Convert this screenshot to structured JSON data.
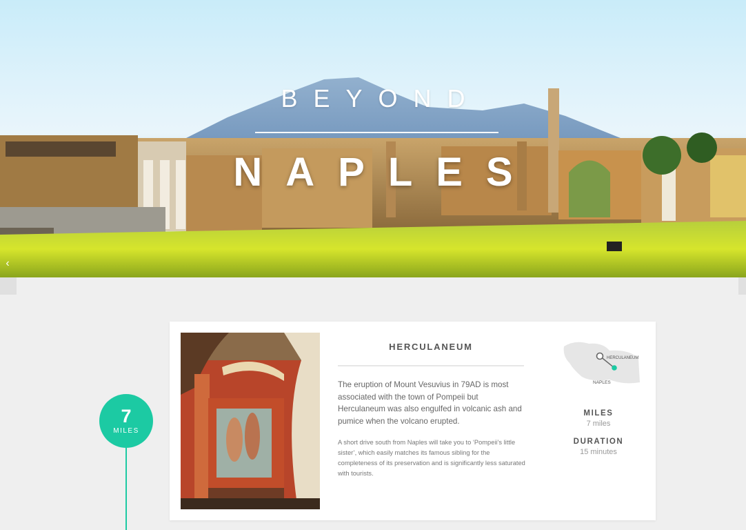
{
  "hero": {
    "title_top": "BEYOND",
    "title_main": "NAPLES",
    "prev_arrow": "‹"
  },
  "timeline": {
    "distance_value": "7",
    "distance_unit": "MILES"
  },
  "card": {
    "title": "HERCULANEUM",
    "paragraph_main": "The eruption of Mount Vesuvius in 79AD is most associated with the town of Pompeii but Herculaneum was also engulfed in volcanic ash and pumice when the volcano erupted.",
    "paragraph_secondary": "A short drive south from Naples will take you to ‘Pompeii’s little sister’, which easily matches its famous sibling for the completeness of its preservation and is significantly less saturated with tourists.",
    "map": {
      "label_destination": "HERCULANEUM",
      "label_origin": "NAPLES"
    },
    "stats": {
      "miles_label": "MILES",
      "miles_value": "7 miles",
      "duration_label": "DURATION",
      "duration_value": "15 minutes"
    }
  },
  "colors": {
    "accent": "#1ccaa3",
    "page_background": "#efefef",
    "card_background": "#ffffff"
  }
}
